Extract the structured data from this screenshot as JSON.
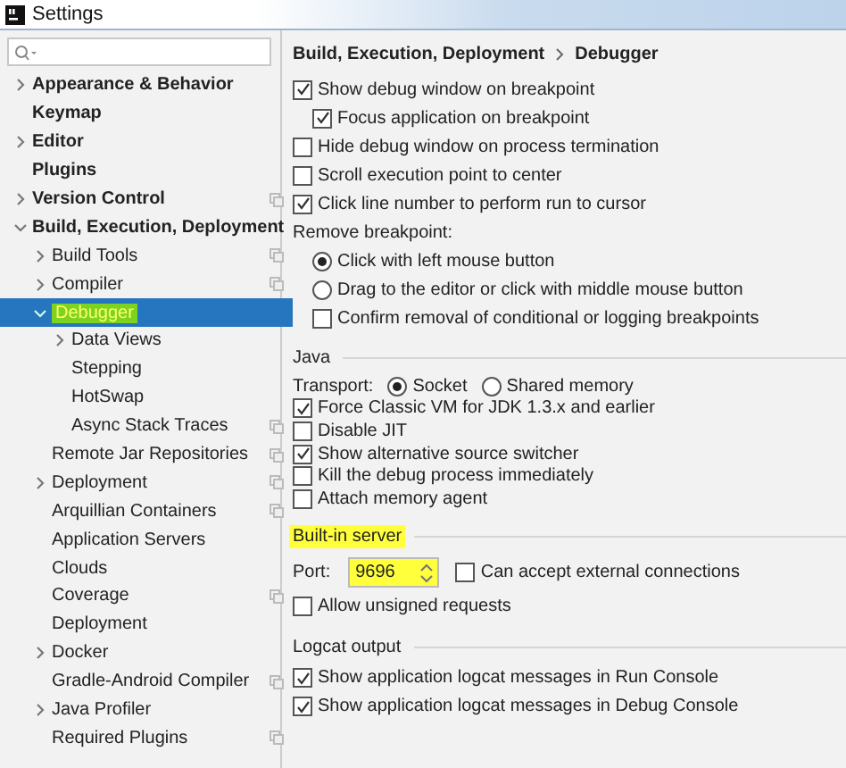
{
  "window": {
    "title": "Settings"
  },
  "sidebar": {
    "items": [
      {
        "label": "Appearance & Behavior",
        "expanded": false
      },
      {
        "label": "Keymap"
      },
      {
        "label": "Editor",
        "expanded": false
      },
      {
        "label": "Plugins"
      },
      {
        "label": "Version Control",
        "expanded": false,
        "project_level": true
      },
      {
        "label": "Build, Execution, Deployment",
        "expanded": true,
        "children": [
          {
            "label": "Build Tools",
            "expanded": false,
            "project_level": true
          },
          {
            "label": "Compiler",
            "expanded": false,
            "project_level": true
          },
          {
            "label": "Debugger",
            "expanded": true,
            "selected": true,
            "highlighted": true,
            "children": [
              {
                "label": "Data Views",
                "expanded": false
              },
              {
                "label": "Stepping"
              },
              {
                "label": "HotSwap"
              },
              {
                "label": "Async Stack Traces",
                "project_level": true
              }
            ]
          },
          {
            "label": "Remote Jar Repositories",
            "project_level": true
          },
          {
            "label": "Deployment",
            "expanded": false,
            "project_level": true
          },
          {
            "label": "Arquillian Containers",
            "project_level": true
          },
          {
            "label": "Application Servers"
          },
          {
            "label": "Clouds"
          },
          {
            "label": "Coverage",
            "project_level": true
          },
          {
            "label": "Deployment"
          },
          {
            "label": "Docker",
            "expanded": false
          },
          {
            "label": "Gradle-Android Compiler",
            "project_level": true
          },
          {
            "label": "Java Profiler",
            "expanded": false
          },
          {
            "label": "Required Plugins",
            "project_level": true
          }
        ]
      }
    ]
  },
  "content": {
    "breadcrumb": [
      "Build, Execution, Deployment",
      "Debugger"
    ],
    "groups": [
      {
        "rows": [
          {
            "kind": "checkbox",
            "label": "Show debug window on breakpoint",
            "checked": true,
            "children": [
              {
                "kind": "checkbox",
                "label": "Focus application on breakpoint",
                "checked": true
              }
            ]
          },
          {
            "kind": "checkbox",
            "label": "Hide debug window on process termination",
            "checked": false
          },
          {
            "kind": "checkbox",
            "label": "Scroll execution point to center",
            "checked": false
          },
          {
            "kind": "checkbox",
            "label": "Click line number to perform run to cursor",
            "checked": true
          },
          {
            "kind": "label",
            "label": "Remove breakpoint:",
            "children": [
              {
                "kind": "radio",
                "label": "Click with left mouse button",
                "selected": true
              },
              {
                "kind": "radio",
                "label": "Drag to the editor or click with middle mouse button",
                "selected": false
              },
              {
                "kind": "checkbox",
                "label": "Confirm removal of conditional or logging breakpoints",
                "checked": false
              }
            ]
          }
        ]
      },
      {
        "title": "Java",
        "highlighted": false,
        "compact": true,
        "rows": [
          {
            "kind": "transport",
            "label": "Transport:",
            "options": [
              {
                "label": "Socket",
                "selected": true
              },
              {
                "label": "Shared memory",
                "selected": false
              }
            ]
          },
          {
            "kind": "checkbox",
            "label": "Force Classic VM for JDK 1.3.x and earlier",
            "checked": true
          },
          {
            "kind": "checkbox",
            "label": "Disable JIT",
            "checked": false
          },
          {
            "kind": "checkbox",
            "label": "Show alternative source switcher",
            "checked": true
          },
          {
            "kind": "checkbox",
            "label": "Kill the debug process immediately",
            "checked": false
          },
          {
            "kind": "checkbox",
            "label": "Attach memory agent",
            "checked": false
          }
        ]
      },
      {
        "title": "Built-in server",
        "highlighted": true,
        "rows": [
          {
            "kind": "port",
            "label": "Port:",
            "value": "9696",
            "highlighted": true,
            "option": {
              "label": "Can accept external connections",
              "checked": false
            }
          },
          {
            "kind": "checkbox",
            "label": "Allow unsigned requests",
            "checked": false
          }
        ]
      },
      {
        "title": "Logcat output",
        "highlighted": false,
        "rows": [
          {
            "kind": "checkbox",
            "label": "Show application logcat messages in Run Console",
            "checked": true
          },
          {
            "kind": "checkbox",
            "label": "Show application logcat messages in Debug Console",
            "checked": true
          }
        ]
      }
    ]
  }
}
